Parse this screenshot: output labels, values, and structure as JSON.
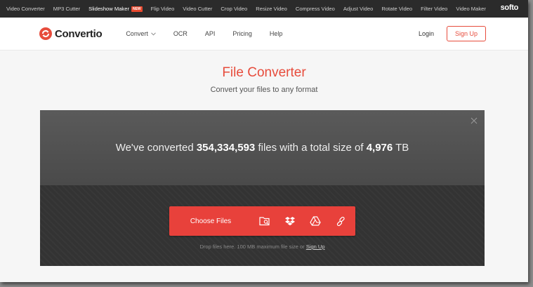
{
  "topbar": {
    "items": [
      {
        "label": "Video Converter"
      },
      {
        "label": "MP3 Cutter"
      },
      {
        "label": "Slideshow Maker",
        "badge": "NEW"
      },
      {
        "label": "Flip Video"
      },
      {
        "label": "Video Cutter"
      },
      {
        "label": "Crop Video"
      },
      {
        "label": "Resize Video"
      },
      {
        "label": "Compress Video"
      },
      {
        "label": "Adjust Video"
      },
      {
        "label": "Rotate Video"
      },
      {
        "label": "Filter Video"
      },
      {
        "label": "Video Maker"
      }
    ],
    "brand": "softo"
  },
  "header": {
    "logo_text": "Convertio",
    "nav": [
      {
        "label": "Convert"
      },
      {
        "label": "OCR"
      },
      {
        "label": "API"
      },
      {
        "label": "Pricing"
      },
      {
        "label": "Help"
      }
    ],
    "login": "Login",
    "signup": "Sign Up"
  },
  "hero": {
    "title": "File Converter",
    "subtitle": "Convert your files to any format"
  },
  "panel": {
    "stats_prefix": "We've converted",
    "files_count": "354,334,593",
    "stats_middle": "files with a total size of",
    "total_size": "4,976",
    "size_unit": "TB",
    "choose_label": "Choose Files",
    "drop_note": "Drop files here. 100 MB maximum file size or",
    "drop_link": "Sign Up"
  },
  "colors": {
    "accent": "#e74c3c",
    "button": "#e8413b",
    "topbar_bg": "#2b2b2b",
    "panel_bg": "#3a3a3a"
  },
  "icons": {
    "source_icons": [
      "folder-search-icon",
      "dropbox-icon",
      "google-drive-icon",
      "link-icon"
    ],
    "close": "close-icon",
    "chevron": "chevron-down-icon"
  }
}
